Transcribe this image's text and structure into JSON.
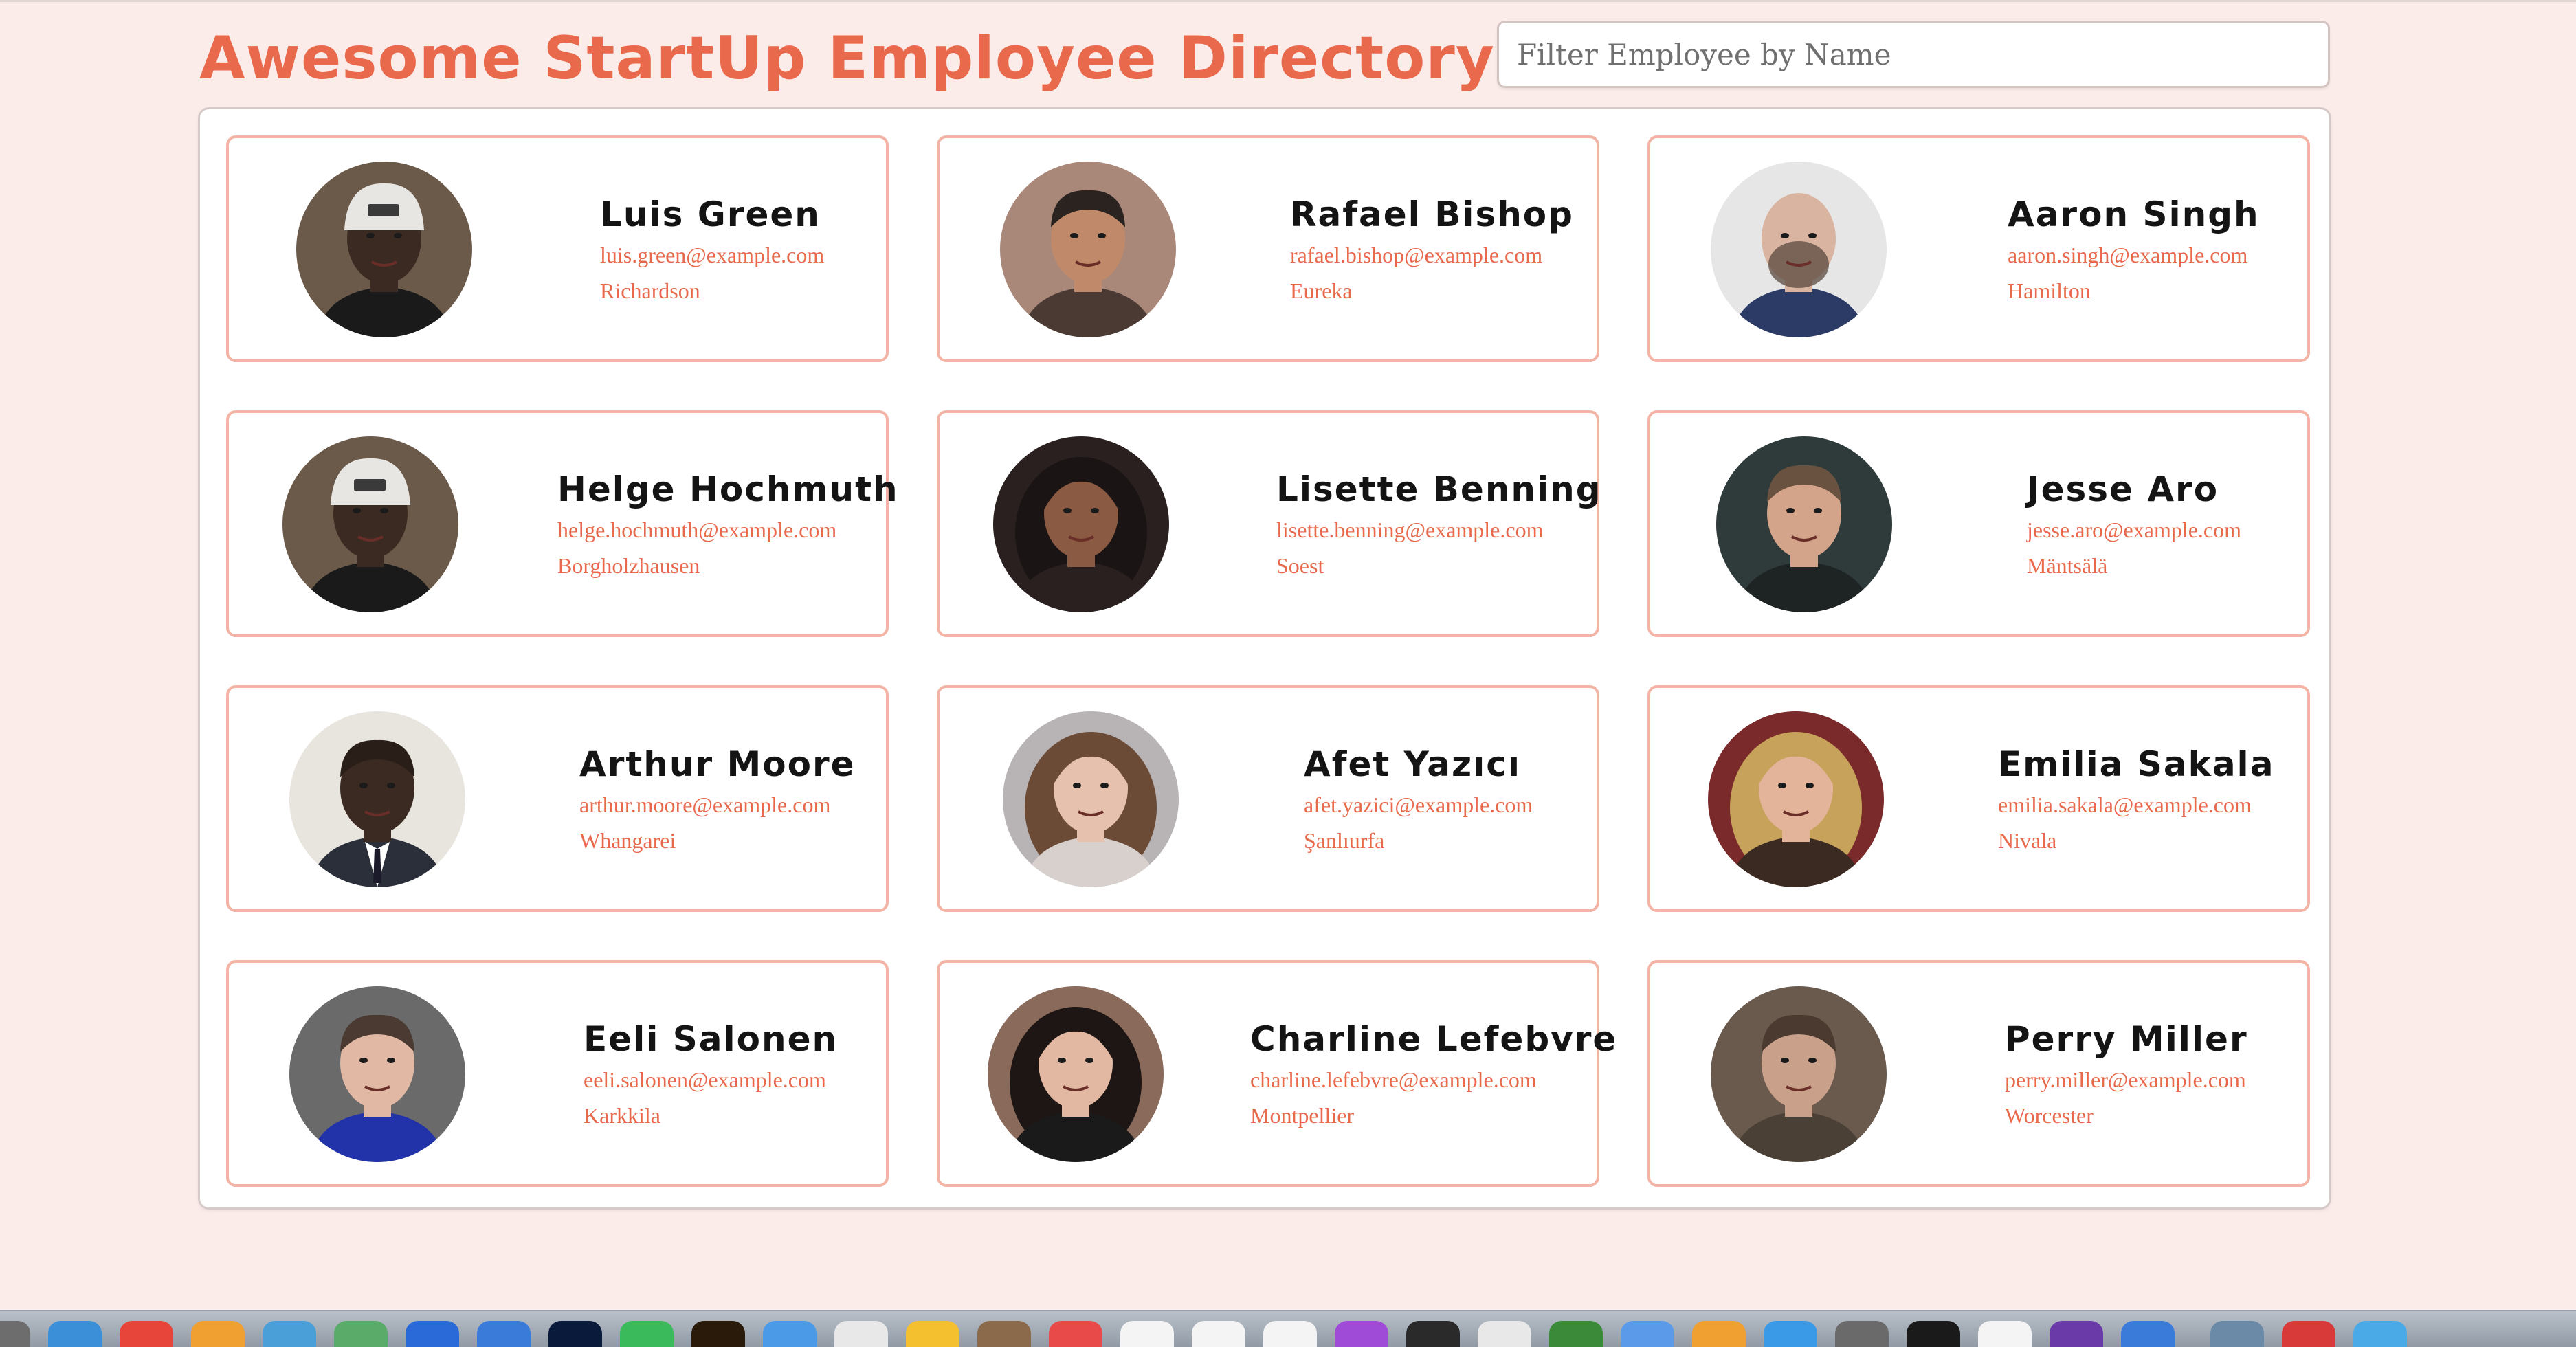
{
  "header": {
    "title": "Awesome StartUp Employee Directory",
    "filter_placeholder": "Filter Employee by Name"
  },
  "employees": [
    {
      "name": "Luis Green",
      "email": "luis.green@example.com",
      "city": "Richardson",
      "avatar": "man-white-cap"
    },
    {
      "name": "Rafael Bishop",
      "email": "rafael.bishop@example.com",
      "city": "Eureka",
      "avatar": "man-smiling"
    },
    {
      "name": "Aaron Singh",
      "email": "aaron.singh@example.com",
      "city": "Hamilton",
      "avatar": "man-bald-beard"
    },
    {
      "name": "Helge Hochmuth",
      "email": "helge.hochmuth@example.com",
      "city": "Borgholzhausen",
      "avatar": "man-white-cap"
    },
    {
      "name": "Lisette Benning",
      "email": "lisette.benning@example.com",
      "city": "Soest",
      "avatar": "woman-curly-hair"
    },
    {
      "name": "Jesse Aro",
      "email": "jesse.aro@example.com",
      "city": "Mäntsälä",
      "avatar": "man-short-hair"
    },
    {
      "name": "Arthur Moore",
      "email": "arthur.moore@example.com",
      "city": "Whangarei",
      "avatar": "man-suit"
    },
    {
      "name": "Afet Yazıcı",
      "email": "afet.yazici@example.com",
      "city": "Şanlıurfa",
      "avatar": "woman-wavy-hair"
    },
    {
      "name": "Emilia Sakala",
      "email": "emilia.sakala@example.com",
      "city": "Nivala",
      "avatar": "woman-blonde"
    },
    {
      "name": "Eeli Salonen",
      "email": "eeli.salonen@example.com",
      "city": "Karkkila",
      "avatar": "man-young"
    },
    {
      "name": "Charline Lefebvre",
      "email": "charline.lefebvre@example.com",
      "city": "Montpellier",
      "avatar": "woman-dark-hair"
    },
    {
      "name": "Perry Miller",
      "email": "perry.miller@example.com",
      "city": "Worcester",
      "avatar": "man-stubble"
    }
  ],
  "colors": {
    "accent": "#e8694b",
    "card_border": "#f3b4a5",
    "background": "#fbecea"
  }
}
